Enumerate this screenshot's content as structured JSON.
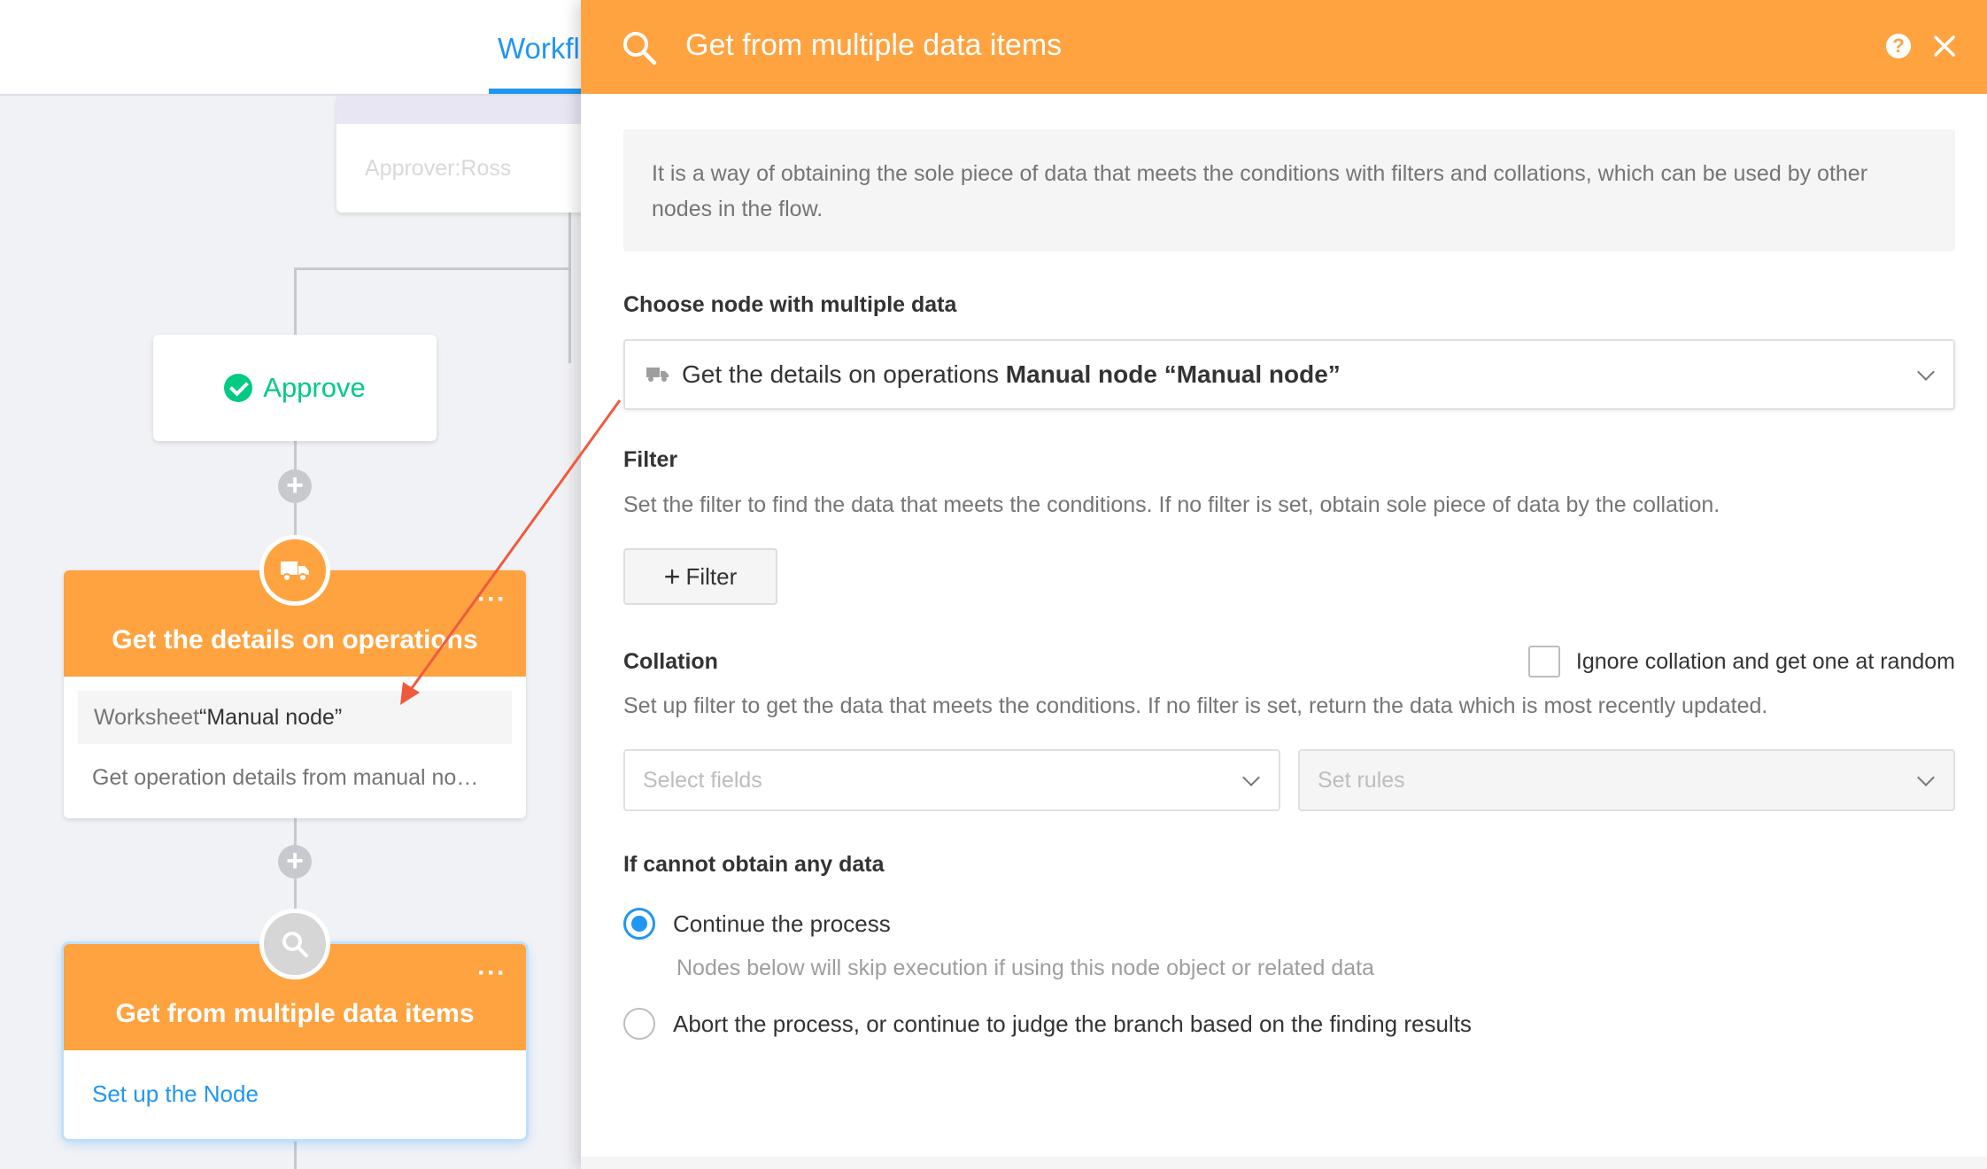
{
  "header": {
    "tab_label": "Workflow"
  },
  "canvas": {
    "approver_card": {
      "approver_text": "Approver:Ross"
    },
    "approve_node": {
      "label": "Approve"
    },
    "operations_node": {
      "title": "Get the details on operations",
      "worksheet_prefix": "Worksheet",
      "worksheet_name": "“Manual node”",
      "details": "Get operation details from manual no…"
    },
    "multi_data_node": {
      "title": "Get from multiple data items",
      "setup_link": "Set up the Node"
    }
  },
  "panel": {
    "title": "Get from multiple data items",
    "description": "It is a way of obtaining the sole piece of data that meets the conditions with filters and collations, which can be used by other nodes in the flow.",
    "choose_node": {
      "label": "Choose node with multiple data",
      "selected_prefix": "Get the details on operations",
      "selected_bold": "Manual node “Manual node”"
    },
    "filter": {
      "label": "Filter",
      "hint": "Set the filter to find the data that meets the conditions. If no filter is set, obtain sole piece of data by the collation.",
      "button_label": "Filter"
    },
    "collation": {
      "label": "Collation",
      "checkbox_label": "Ignore collation and get one at random",
      "hint": "Set up filter to get the data that meets the conditions. If no filter is set, return the data which is most recently updated.",
      "fields_placeholder": "Select fields",
      "rules_placeholder": "Set rules"
    },
    "no_data": {
      "label": "If cannot obtain any data",
      "option_continue": "Continue the process",
      "option_continue_hint": "Nodes below will skip execution if using this node object or related data",
      "option_abort": "Abort the process, or continue to judge the branch based on the finding results"
    }
  },
  "colors": {
    "accent_orange": "#ffa340",
    "primary_blue": "#2196f3",
    "approve_green": "#01ca83"
  }
}
